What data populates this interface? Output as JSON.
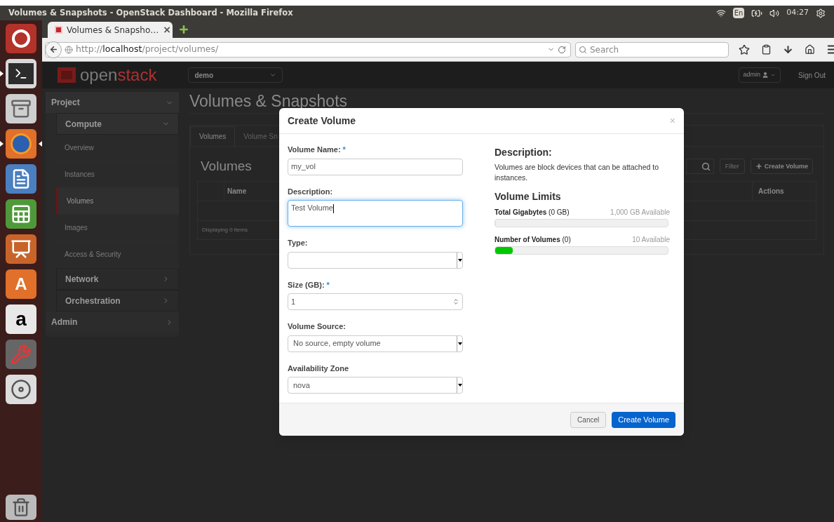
{
  "top_bar": {
    "title": "Volumes & Snapshots - OpenStack Dashboard - Mozilla Firefox",
    "keyboard": "En",
    "clock": "04:27"
  },
  "launcher": [
    {
      "kind": "dash",
      "running": false,
      "focused": false
    },
    {
      "kind": "terminal",
      "running": true,
      "focused": false
    },
    {
      "kind": "files",
      "running": false,
      "focused": false
    },
    {
      "kind": "firefox",
      "running": true,
      "focused": true
    },
    {
      "kind": "writer",
      "running": false,
      "focused": false
    },
    {
      "kind": "calc",
      "running": false,
      "focused": false
    },
    {
      "kind": "impress",
      "running": false,
      "focused": false
    },
    {
      "kind": "software",
      "glyph": "A",
      "running": false,
      "focused": false
    },
    {
      "kind": "amazon",
      "glyph": "a",
      "running": false,
      "focused": false
    },
    {
      "kind": "settings",
      "running": false,
      "focused": false
    },
    {
      "kind": "disc",
      "running": false,
      "focused": false
    }
  ],
  "trash": {
    "running": false
  },
  "browser": {
    "tabs": [
      {
        "title": "Volumes & Snapsho…",
        "close": "×",
        "selected": true
      }
    ],
    "url": {
      "scheme": "http://",
      "host": "localhost",
      "path": "/project/volumes/"
    },
    "search_placeholder": "Search"
  },
  "page": {
    "logo": [
      "open",
      "stack"
    ],
    "project_selector": "demo",
    "user_menu": "admin",
    "sign_out": "Sign Out",
    "sidebar": [
      {
        "label": "Project",
        "expanded": true,
        "children": [
          {
            "label": "Compute",
            "expanded": true,
            "children": [
              {
                "label": "Overview",
                "selected": false
              },
              {
                "label": "Instances",
                "selected": false
              },
              {
                "label": "Volumes",
                "selected": true
              },
              {
                "label": "Images",
                "selected": false
              },
              {
                "label": "Access & Security",
                "selected": false
              }
            ]
          },
          {
            "label": "Network",
            "expanded": false
          },
          {
            "label": "Orchestration",
            "expanded": false
          }
        ]
      },
      {
        "label": "Admin",
        "expanded": false
      }
    ],
    "heading": "Volumes & Snapshots",
    "tabs": [
      {
        "label": "Volumes",
        "selected": true
      },
      {
        "label": "Volume Sn",
        "selected": false
      }
    ],
    "table": {
      "title": "Volumes",
      "filter_button": "Filter",
      "create_button": "Create Volume",
      "columns": [
        "Name",
        "Actions"
      ],
      "footer": "Displaying 0 items"
    }
  },
  "modal": {
    "title": "Create Volume",
    "close": "×",
    "fields": [
      {
        "kind": "text",
        "label": "Volume Name:",
        "required_mark": "*",
        "value": "my_vol",
        "focused": false
      },
      {
        "kind": "textarea",
        "label": "Description:",
        "value": "Test Volume",
        "focused": true
      },
      {
        "kind": "select",
        "label": "Type:",
        "focused": false
      },
      {
        "kind": "number",
        "label": "Size (GB):",
        "required_mark": "*",
        "value": "1",
        "focused": false
      },
      {
        "kind": "select",
        "label": "Volume Source:",
        "value": "No source, empty volume",
        "focused": false
      },
      {
        "kind": "select",
        "label": "Availability Zone",
        "value": "nova",
        "focused": false
      }
    ],
    "description_title": "Description:",
    "description": "Volumes are block devices that can be attached to instances.",
    "limits_title": "Volume Limits",
    "limits": [
      {
        "label": "Total Gigabytes",
        "used": "(0 GB)",
        "available": "1,000 GB Available",
        "level": 0
      },
      {
        "label": "Number of Volumes",
        "used": "(0)",
        "available": "10 Available",
        "level": 0.1
      }
    ],
    "buttons": [
      {
        "label": "Cancel",
        "kind": "secondary"
      },
      {
        "label": "Create Volume",
        "kind": "primary"
      }
    ]
  }
}
